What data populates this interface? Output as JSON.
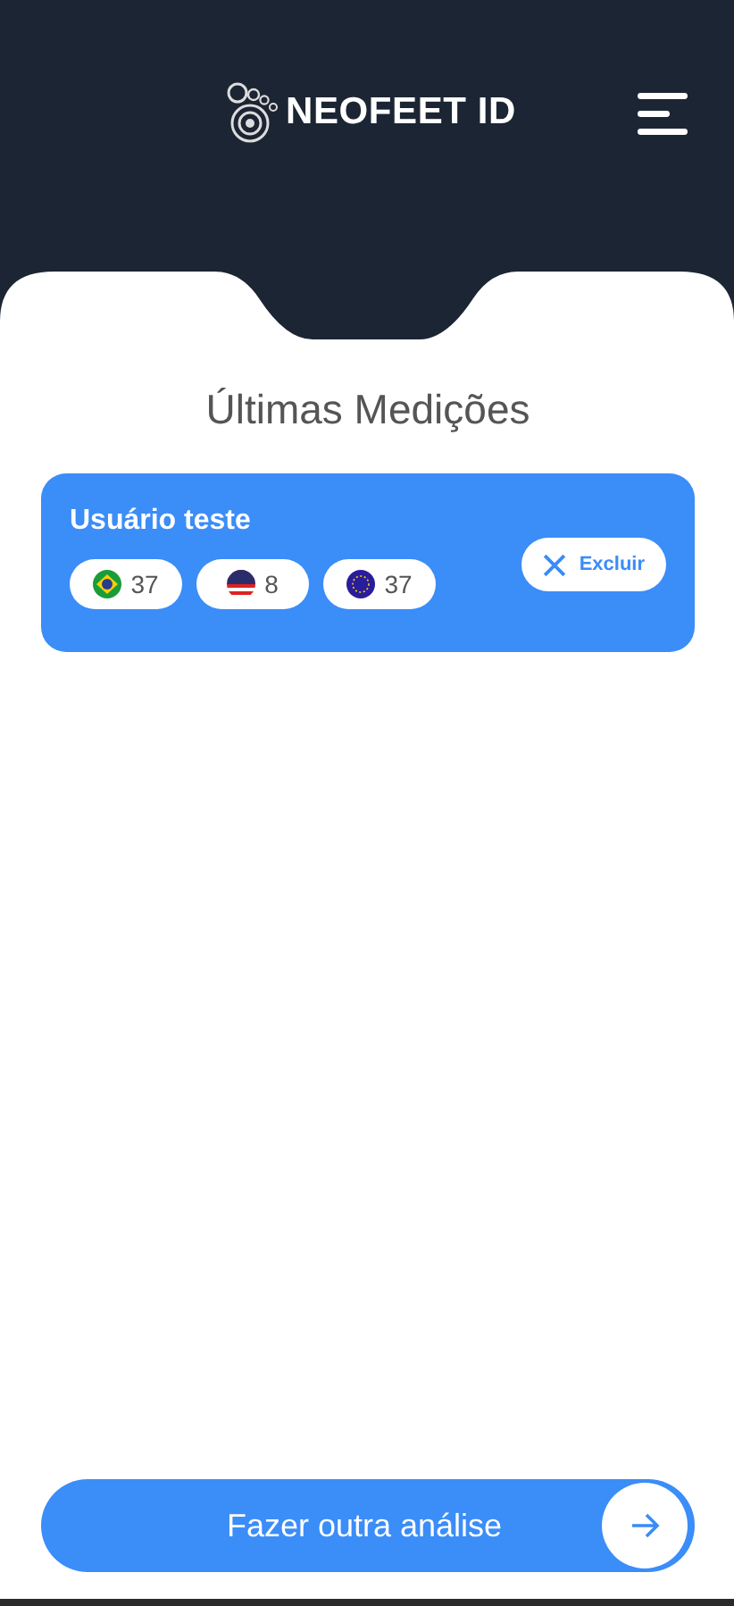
{
  "header": {
    "logo_text": "NEOFEET ID"
  },
  "title": "Últimas Medições",
  "measurements": [
    {
      "name": "Usuário teste",
      "badges": [
        {
          "kind": "br",
          "value": "37"
        },
        {
          "kind": "us",
          "value": "8"
        },
        {
          "kind": "eu",
          "value": "37"
        }
      ],
      "delete_label": "Excluir"
    }
  ],
  "action_button": {
    "label": "Fazer outra análise"
  }
}
